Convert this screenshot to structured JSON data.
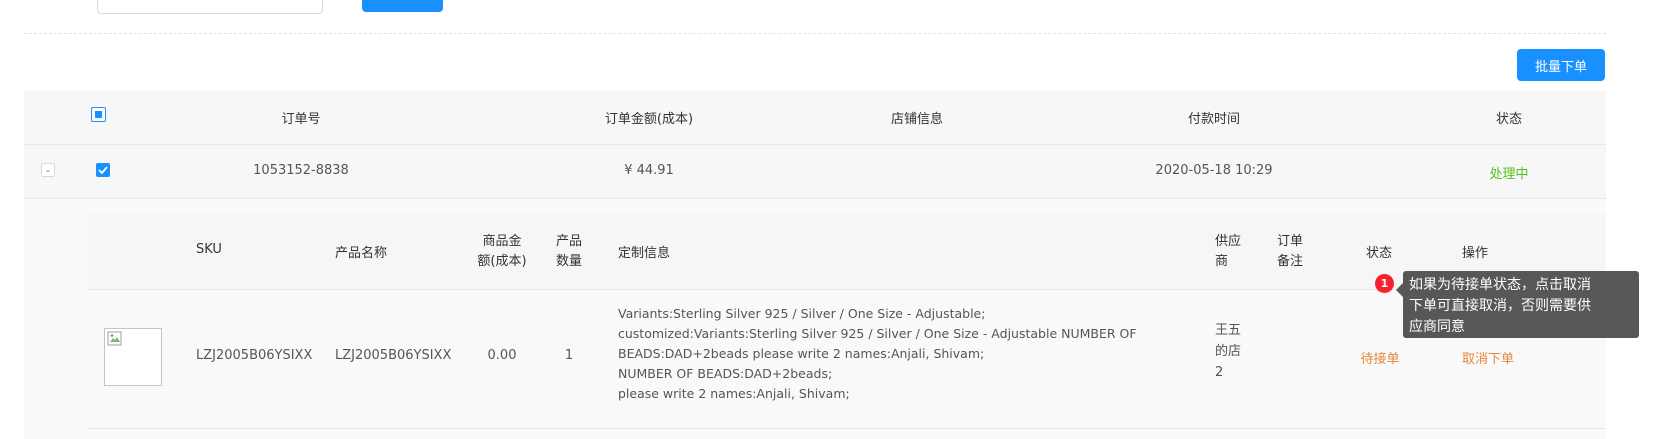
{
  "toolbar": {
    "batch_order_label": "批量下单"
  },
  "table": {
    "headers": [
      "订单号",
      "订单金额(成本)",
      "店铺信息",
      "付款时间",
      "状态"
    ],
    "order": {
      "collapse_symbol": "-",
      "order_no": "1053152-8838",
      "amount": "¥ 44.91",
      "store": "",
      "paid_time": "2020-05-18 10:29",
      "status": "处理中",
      "status_color": "#52c41a"
    }
  },
  "subtable": {
    "headers": {
      "sku": "SKU",
      "product_name": "产品名称",
      "price_1": "商品金",
      "price_2": "额(成本)",
      "qty_1": "产品",
      "qty_2": "数量",
      "custom": "定制信息",
      "supplier_1": "供应",
      "supplier_2": "商",
      "remark_1": "订单",
      "remark_2": "备注",
      "status": "状态",
      "action": "操作"
    },
    "row": {
      "image_icon": "broken-image-icon",
      "sku": "LZJ2005B06YSIXX",
      "product_name": "LZJ2005B06YSIXX",
      "price": "0.00",
      "qty": "1",
      "custom_lines": [
        "Variants:Sterling Silver 925 / Silver / One Size - Adjustable;",
        "customized:Variants:Sterling Silver 925 / Silver / One Size - Adjustable NUMBER OF",
        "BEADS:DAD+2beads please write 2 names:Anjali, Shivam;",
        "NUMBER OF BEADS:DAD+2beads;",
        "please write 2 names:Anjali, Shivam;"
      ],
      "supplier_lines": [
        "王五",
        "的店",
        "2"
      ],
      "remark": "",
      "status": "待接单",
      "action": "取消下单",
      "accent_color": "#e6883a"
    }
  },
  "tooltip": {
    "badge": "1",
    "lines": [
      "如果为待接单状态，点击取消",
      "下单可直接取消，否则需要供",
      "应商同意"
    ]
  }
}
